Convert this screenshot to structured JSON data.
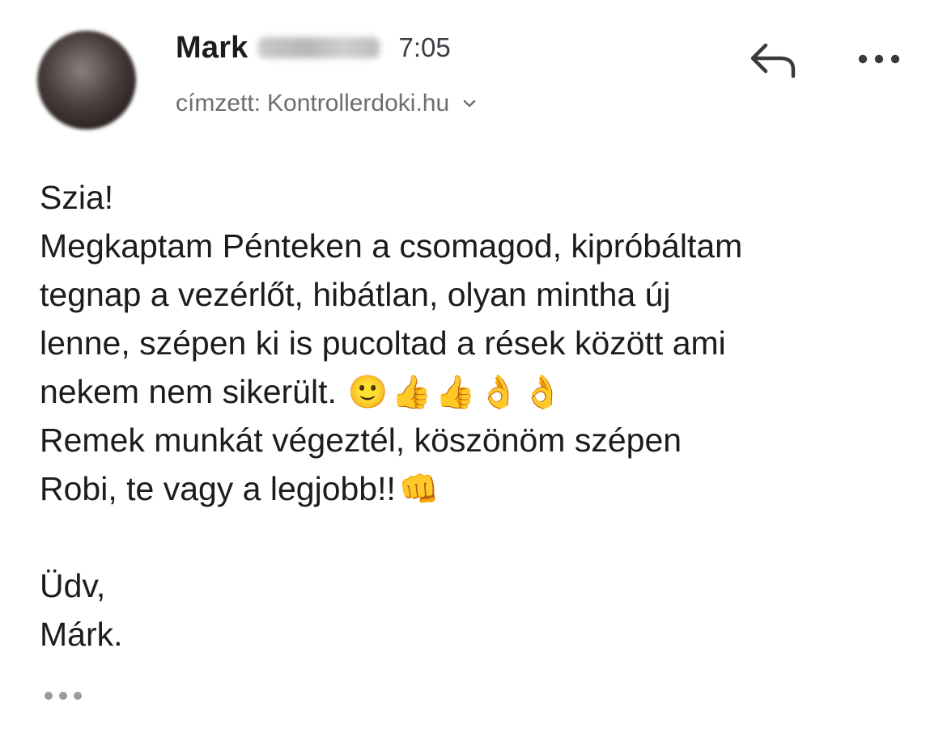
{
  "sender": {
    "name": "Mark",
    "time": "7:05"
  },
  "recipient": {
    "prefix": "címzett:",
    "address": "Kontrollerdoki.hu"
  },
  "icons": {
    "reply": "reply-arrow-icon",
    "more": "more-horizontal-icon",
    "expand": "chevron-down-icon",
    "trimmed": "ellipsis-icon"
  },
  "message": {
    "greeting": "Szia!",
    "line1": "Megkaptam Pénteken a csomagod, kipróbáltam",
    "line2": "tegnap a vezérlőt, hibátlan, olyan mintha új",
    "line3": "lenne, szépen ki is pucoltad a rések között ami",
    "line4": "nekem nem sikerült.",
    "line4_emojis": [
      "🙂",
      "👍",
      "👍",
      "👌",
      "👌"
    ],
    "line5": "Remek munkát végeztél, köszönöm szépen",
    "line6": "Robi, te vagy a legjobb!!",
    "line6_emoji": "👊",
    "signoff": "Üdv,",
    "signature": "Márk."
  },
  "colors": {
    "text": "#1c1c1e",
    "secondary": "#6d6d72",
    "icon": "#3a3a3c",
    "emoji": "#f2b53a"
  }
}
